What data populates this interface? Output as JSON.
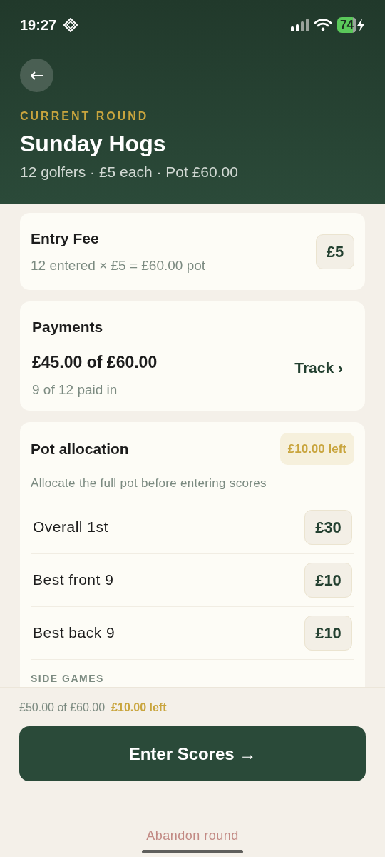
{
  "status_bar": {
    "time": "19:27",
    "battery": "74"
  },
  "header": {
    "eyebrow": "CURRENT ROUND",
    "title": "Sunday Hogs",
    "subtitle": "12 golfers · £5 each · Pot £60.00"
  },
  "entry_fee": {
    "title": "Entry Fee",
    "detail": "12 entered × £5 = £60.00 pot",
    "amount": "£5"
  },
  "payments": {
    "title": "Payments",
    "total": "£45.00 of £60.00",
    "detail": "9 of 12 paid in",
    "link": "Track ›"
  },
  "pot_allocation": {
    "title": "Pot allocation",
    "badge": "£10.00 left",
    "hint": "Allocate the full pot before entering scores",
    "prizes": [
      {
        "label": "Overall 1st",
        "amount": "£30"
      },
      {
        "label": "Best front 9",
        "amount": "£10"
      },
      {
        "label": "Best back 9",
        "amount": "£10"
      }
    ],
    "section": "SIDE GAMES"
  },
  "footer": {
    "allocated": "£50.00 of £60.00",
    "left": "£10.00 left",
    "button": "Enter Scores →",
    "abandon": "Abandon round"
  }
}
